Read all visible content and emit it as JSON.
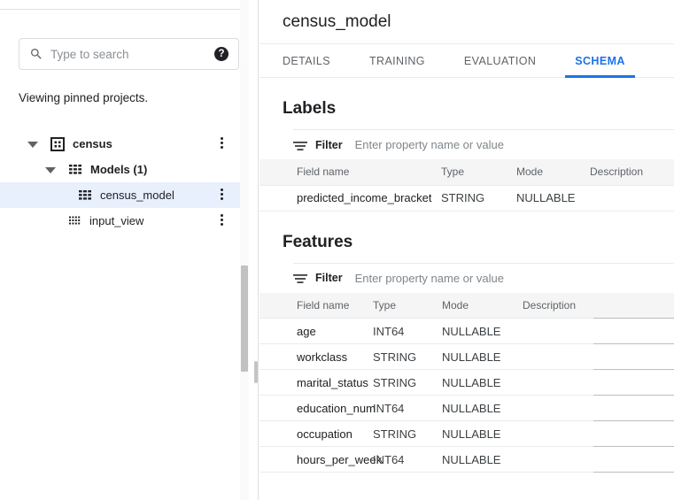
{
  "sidebar": {
    "search": {
      "placeholder": "Type to search",
      "value": "",
      "help_label": "?"
    },
    "pinned_note": "Viewing pinned projects.",
    "tree": [
      {
        "label": "census",
        "icon": "project-icon",
        "indent": 0,
        "expanded": true,
        "bold": true,
        "selected": false,
        "has_menu": true
      },
      {
        "label": "Models (1)",
        "icon": "models-table-icon",
        "indent": 1,
        "expanded": true,
        "bold": true,
        "selected": false,
        "has_menu": false
      },
      {
        "label": "census_model",
        "icon": "model-table-icon",
        "indent": 2,
        "expanded": null,
        "bold": false,
        "selected": true,
        "has_menu": true
      },
      {
        "label": "input_view",
        "icon": "view-grid-icon",
        "indent": 2,
        "expanded": null,
        "bold": false,
        "selected": false,
        "has_menu": true
      }
    ]
  },
  "content": {
    "title": "census_model",
    "tabs": [
      {
        "label": "DETAILS",
        "active": false
      },
      {
        "label": "TRAINING",
        "active": false
      },
      {
        "label": "EVALUATION",
        "active": false
      },
      {
        "label": "SCHEMA",
        "active": true
      }
    ],
    "accent_color": "#1a73e8",
    "sections": [
      {
        "title": "Labels",
        "filter": {
          "label": "Filter",
          "placeholder": "Enter property name or value",
          "value": ""
        },
        "columns": [
          "Field name",
          "Type",
          "Mode",
          "Description"
        ],
        "rows": [
          {
            "field": "predicted_income_bracket",
            "type": "STRING",
            "mode": "NULLABLE",
            "description": ""
          }
        ]
      },
      {
        "title": "Features",
        "filter": {
          "label": "Filter",
          "placeholder": "Enter property name or value",
          "value": ""
        },
        "columns": [
          "Field name",
          "Type",
          "Mode",
          "Description",
          ""
        ],
        "rows": [
          {
            "field": "age",
            "type": "INT64",
            "mode": "NULLABLE",
            "description": ""
          },
          {
            "field": "workclass",
            "type": "STRING",
            "mode": "NULLABLE",
            "description": ""
          },
          {
            "field": "marital_status",
            "type": "STRING",
            "mode": "NULLABLE",
            "description": ""
          },
          {
            "field": "education_num",
            "type": "INT64",
            "mode": "NULLABLE",
            "description": ""
          },
          {
            "field": "occupation",
            "type": "STRING",
            "mode": "NULLABLE",
            "description": ""
          },
          {
            "field": "hours_per_week",
            "type": "INT64",
            "mode": "NULLABLE",
            "description": ""
          }
        ]
      }
    ]
  }
}
